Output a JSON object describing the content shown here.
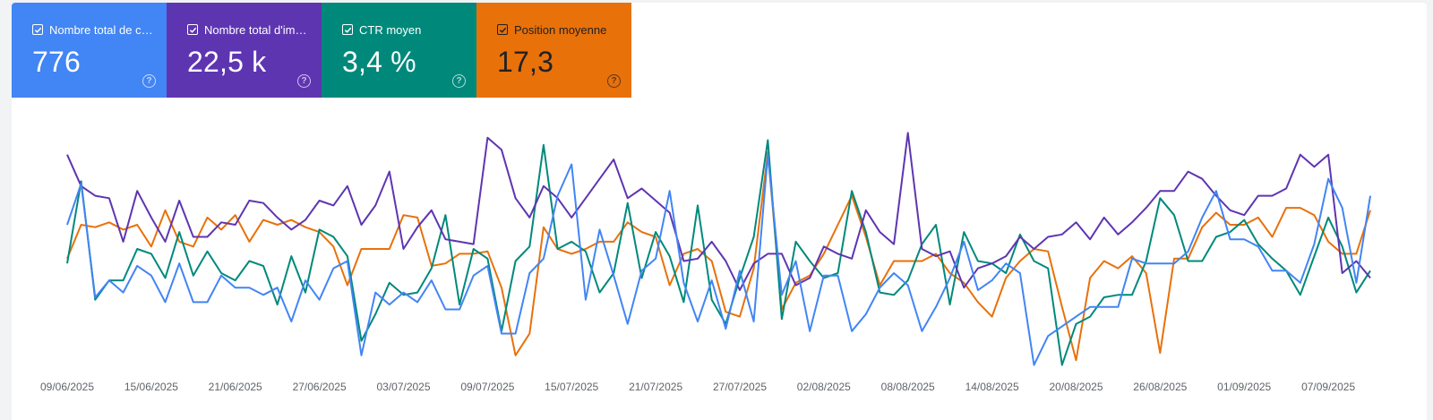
{
  "metrics": [
    {
      "label": "Nombre total de clics",
      "value": "776",
      "color": "#4285f4",
      "text": "light",
      "icon": "help-icon"
    },
    {
      "label": "Nombre total d'impressions",
      "value": "22,5 k",
      "color": "#5e35b1",
      "text": "light",
      "icon": "help-icon"
    },
    {
      "label": "CTR moyen",
      "value": "3,4 %",
      "color": "#00897b",
      "text": "light",
      "icon": "help-icon"
    },
    {
      "label": "Position moyenne",
      "value": "17,3",
      "color": "#e8710a",
      "text": "dark",
      "icon": "help-icon"
    }
  ],
  "chart_data": {
    "type": "line",
    "x_start": "09/06/2025",
    "x_end": "08/09/2025",
    "x_tick_labels": [
      "09/06/2025",
      "15/06/2025",
      "21/06/2025",
      "27/06/2025",
      "03/07/2025",
      "09/07/2025",
      "15/07/2025",
      "21/07/2025",
      "27/07/2025",
      "02/08/2025",
      "08/08/2025",
      "14/08/2025",
      "20/08/2025",
      "26/08/2025",
      "01/09/2025",
      "07/09/2025"
    ],
    "y_axis_shown": false,
    "grid": false,
    "legend": "metric cards (top)",
    "series": [
      {
        "name": "Nombre total de clics",
        "color": "#4285f4",
        "values": [
          0.6,
          0.77,
          0.3,
          0.37,
          0.32,
          0.43,
          0.39,
          0.28,
          0.44,
          0.28,
          0.28,
          0.39,
          0.34,
          0.34,
          0.31,
          0.34,
          0.2,
          0.37,
          0.29,
          0.42,
          0.45,
          0.06,
          0.32,
          0.27,
          0.32,
          0.28,
          0.37,
          0.25,
          0.25,
          0.39,
          0.43,
          0.15,
          0.15,
          0.4,
          0.46,
          0.72,
          0.85,
          0.29,
          0.58,
          0.39,
          0.19,
          0.41,
          0.46,
          0.74,
          0.36,
          0.2,
          0.37,
          0.17,
          0.41,
          0.2,
          0.89,
          0.31,
          0.45,
          0.16,
          0.39,
          0.39,
          0.16,
          0.23,
          0.34,
          0.4,
          0.35,
          0.16,
          0.26,
          0.38,
          0.53,
          0.33,
          0.37,
          0.44,
          0.4,
          0.02,
          0.14,
          0.18,
          0.22,
          0.26,
          0.26,
          0.26,
          0.46,
          0.44,
          0.44,
          0.44,
          0.49,
          0.63,
          0.74,
          0.54,
          0.54,
          0.51,
          0.41,
          0.41,
          0.36,
          0.52,
          0.79,
          0.67,
          0.36,
          0.72
        ]
      },
      {
        "name": "Nombre total d'impressions",
        "color": "#5e35b1",
        "values": [
          0.89,
          0.76,
          0.72,
          0.71,
          0.53,
          0.74,
          0.63,
          0.53,
          0.7,
          0.55,
          0.55,
          0.61,
          0.6,
          0.7,
          0.69,
          0.63,
          0.58,
          0.62,
          0.7,
          0.68,
          0.76,
          0.6,
          0.68,
          0.82,
          0.5,
          0.59,
          0.66,
          0.54,
          0.53,
          0.52,
          0.96,
          0.91,
          0.71,
          0.63,
          0.76,
          0.71,
          0.63,
          0.71,
          0.79,
          0.87,
          0.71,
          0.75,
          0.7,
          0.65,
          0.45,
          0.46,
          0.53,
          0.45,
          0.33,
          0.44,
          0.48,
          0.48,
          0.35,
          0.38,
          0.51,
          0.48,
          0.46,
          0.66,
          0.57,
          0.52,
          0.98,
          0.5,
          0.47,
          0.49,
          0.34,
          0.42,
          0.44,
          0.47,
          0.55,
          0.5,
          0.55,
          0.56,
          0.61,
          0.54,
          0.63,
          0.56,
          0.61,
          0.67,
          0.74,
          0.74,
          0.82,
          0.79,
          0.72,
          0.66,
          0.64,
          0.72,
          0.72,
          0.75,
          0.89,
          0.84,
          0.89,
          0.4,
          0.45,
          0.38
        ]
      },
      {
        "name": "CTR moyen",
        "color": "#00897b",
        "values": [
          0.44,
          0.78,
          0.29,
          0.37,
          0.37,
          0.5,
          0.48,
          0.38,
          0.57,
          0.39,
          0.49,
          0.4,
          0.37,
          0.45,
          0.43,
          0.27,
          0.47,
          0.32,
          0.58,
          0.55,
          0.47,
          0.12,
          0.23,
          0.36,
          0.31,
          0.32,
          0.42,
          0.64,
          0.27,
          0.5,
          0.46,
          0.16,
          0.45,
          0.51,
          0.93,
          0.5,
          0.53,
          0.49,
          0.32,
          0.4,
          0.69,
          0.38,
          0.57,
          0.47,
          0.28,
          0.68,
          0.29,
          0.19,
          0.38,
          0.55,
          0.95,
          0.21,
          0.53,
          0.45,
          0.38,
          0.4,
          0.74,
          0.57,
          0.32,
          0.31,
          0.37,
          0.52,
          0.6,
          0.27,
          0.57,
          0.45,
          0.44,
          0.4,
          0.56,
          0.45,
          0.42,
          0.02,
          0.19,
          0.22,
          0.3,
          0.31,
          0.31,
          0.45,
          0.71,
          0.64,
          0.45,
          0.45,
          0.55,
          0.57,
          0.62,
          0.52,
          0.46,
          0.41,
          0.31,
          0.47,
          0.63,
          0.51,
          0.32,
          0.41
        ]
      },
      {
        "name": "Position moyenne",
        "color": "#e8710a",
        "values": [
          0.46,
          0.6,
          0.59,
          0.61,
          0.58,
          0.6,
          0.51,
          0.66,
          0.53,
          0.51,
          0.63,
          0.58,
          0.64,
          0.53,
          0.62,
          0.6,
          0.62,
          0.59,
          0.57,
          0.51,
          0.35,
          0.5,
          0.5,
          0.5,
          0.64,
          0.63,
          0.43,
          0.44,
          0.48,
          0.48,
          0.49,
          0.34,
          0.06,
          0.15,
          0.59,
          0.5,
          0.48,
          0.5,
          0.53,
          0.53,
          0.61,
          0.57,
          0.55,
          0.35,
          0.48,
          0.5,
          0.45,
          0.24,
          0.22,
          0.42,
          0.9,
          0.25,
          0.36,
          0.39,
          0.48,
          0.6,
          0.72,
          0.55,
          0.35,
          0.45,
          0.45,
          0.45,
          0.48,
          0.4,
          0.36,
          0.28,
          0.22,
          0.38,
          0.45,
          0.5,
          0.49,
          0.26,
          0.04,
          0.38,
          0.45,
          0.42,
          0.47,
          0.4,
          0.07,
          0.46,
          0.46,
          0.59,
          0.65,
          0.6,
          0.6,
          0.63,
          0.55,
          0.67,
          0.67,
          0.64,
          0.53,
          0.48,
          0.48,
          0.66
        ]
      }
    ]
  }
}
